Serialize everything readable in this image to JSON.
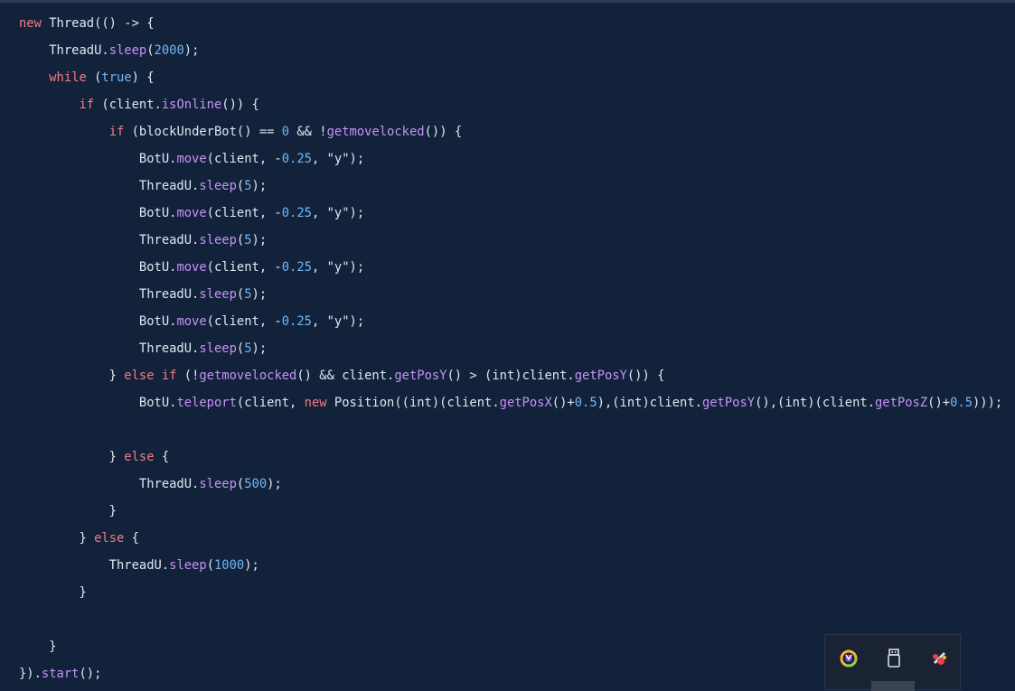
{
  "code_lines": [
    [
      {
        "t": "kw",
        "v": "new"
      },
      {
        "t": "p",
        "v": " Thread(() -> {"
      }
    ],
    [
      {
        "t": "p",
        "v": "    ThreadU."
      },
      {
        "t": "fn",
        "v": "sleep"
      },
      {
        "t": "p",
        "v": "("
      },
      {
        "t": "num",
        "v": "2000"
      },
      {
        "t": "p",
        "v": ");"
      }
    ],
    [
      {
        "t": "p",
        "v": "    "
      },
      {
        "t": "kw",
        "v": "while"
      },
      {
        "t": "p",
        "v": " ("
      },
      {
        "t": "num",
        "v": "true"
      },
      {
        "t": "p",
        "v": ") {"
      }
    ],
    [
      {
        "t": "p",
        "v": "        "
      },
      {
        "t": "kw",
        "v": "if"
      },
      {
        "t": "p",
        "v": " (client."
      },
      {
        "t": "fn",
        "v": "isOnline"
      },
      {
        "t": "p",
        "v": "()) {"
      }
    ],
    [
      {
        "t": "p",
        "v": "            "
      },
      {
        "t": "kw",
        "v": "if"
      },
      {
        "t": "p",
        "v": " (blockUnderBot() == "
      },
      {
        "t": "num",
        "v": "0"
      },
      {
        "t": "p",
        "v": " && !"
      },
      {
        "t": "fn",
        "v": "getmovelocked"
      },
      {
        "t": "p",
        "v": "()) {"
      }
    ],
    [
      {
        "t": "p",
        "v": "                BotU."
      },
      {
        "t": "fn",
        "v": "move"
      },
      {
        "t": "p",
        "v": "(client, -"
      },
      {
        "t": "num",
        "v": "0.25"
      },
      {
        "t": "p",
        "v": ", "
      },
      {
        "t": "str",
        "v": "\"y\""
      },
      {
        "t": "p",
        "v": ");"
      }
    ],
    [
      {
        "t": "p",
        "v": "                ThreadU."
      },
      {
        "t": "fn",
        "v": "sleep"
      },
      {
        "t": "p",
        "v": "("
      },
      {
        "t": "num",
        "v": "5"
      },
      {
        "t": "p",
        "v": ");"
      }
    ],
    [
      {
        "t": "p",
        "v": "                BotU."
      },
      {
        "t": "fn",
        "v": "move"
      },
      {
        "t": "p",
        "v": "(client, -"
      },
      {
        "t": "num",
        "v": "0.25"
      },
      {
        "t": "p",
        "v": ", "
      },
      {
        "t": "str",
        "v": "\"y\""
      },
      {
        "t": "p",
        "v": ");"
      }
    ],
    [
      {
        "t": "p",
        "v": "                ThreadU."
      },
      {
        "t": "fn",
        "v": "sleep"
      },
      {
        "t": "p",
        "v": "("
      },
      {
        "t": "num",
        "v": "5"
      },
      {
        "t": "p",
        "v": ");"
      }
    ],
    [
      {
        "t": "p",
        "v": "                BotU."
      },
      {
        "t": "fn",
        "v": "move"
      },
      {
        "t": "p",
        "v": "(client, -"
      },
      {
        "t": "num",
        "v": "0.25"
      },
      {
        "t": "p",
        "v": ", "
      },
      {
        "t": "str",
        "v": "\"y\""
      },
      {
        "t": "p",
        "v": ");"
      }
    ],
    [
      {
        "t": "p",
        "v": "                ThreadU."
      },
      {
        "t": "fn",
        "v": "sleep"
      },
      {
        "t": "p",
        "v": "("
      },
      {
        "t": "num",
        "v": "5"
      },
      {
        "t": "p",
        "v": ");"
      }
    ],
    [
      {
        "t": "p",
        "v": "                BotU."
      },
      {
        "t": "fn",
        "v": "move"
      },
      {
        "t": "p",
        "v": "(client, -"
      },
      {
        "t": "num",
        "v": "0.25"
      },
      {
        "t": "p",
        "v": ", "
      },
      {
        "t": "str",
        "v": "\"y\""
      },
      {
        "t": "p",
        "v": ");"
      }
    ],
    [
      {
        "t": "p",
        "v": "                ThreadU."
      },
      {
        "t": "fn",
        "v": "sleep"
      },
      {
        "t": "p",
        "v": "("
      },
      {
        "t": "num",
        "v": "5"
      },
      {
        "t": "p",
        "v": ");"
      }
    ],
    [
      {
        "t": "p",
        "v": "            } "
      },
      {
        "t": "kw",
        "v": "else if"
      },
      {
        "t": "p",
        "v": " (!"
      },
      {
        "t": "fn",
        "v": "getmovelocked"
      },
      {
        "t": "p",
        "v": "() && client."
      },
      {
        "t": "fn",
        "v": "getPosY"
      },
      {
        "t": "p",
        "v": "() > (int)client."
      },
      {
        "t": "fn",
        "v": "getPosY"
      },
      {
        "t": "p",
        "v": "()) {"
      }
    ],
    [
      {
        "t": "p",
        "v": "                BotU."
      },
      {
        "t": "fn",
        "v": "teleport"
      },
      {
        "t": "p",
        "v": "(client, "
      },
      {
        "t": "kw",
        "v": "new"
      },
      {
        "t": "p",
        "v": " Position((int)(client."
      },
      {
        "t": "fn",
        "v": "getPosX"
      },
      {
        "t": "p",
        "v": "()+"
      },
      {
        "t": "num",
        "v": "0.5"
      },
      {
        "t": "p",
        "v": "),(int)client."
      },
      {
        "t": "fn",
        "v": "getPosY"
      },
      {
        "t": "p",
        "v": "(),(int)(client."
      },
      {
        "t": "fn",
        "v": "getPosZ"
      },
      {
        "t": "p",
        "v": "()+"
      },
      {
        "t": "num",
        "v": "0.5"
      },
      {
        "t": "p",
        "v": ")));"
      }
    ],
    [
      {
        "t": "p",
        "v": ""
      }
    ],
    [
      {
        "t": "p",
        "v": "            } "
      },
      {
        "t": "kw",
        "v": "else"
      },
      {
        "t": "p",
        "v": " {"
      }
    ],
    [
      {
        "t": "p",
        "v": "                ThreadU."
      },
      {
        "t": "fn",
        "v": "sleep"
      },
      {
        "t": "p",
        "v": "("
      },
      {
        "t": "num",
        "v": "500"
      },
      {
        "t": "p",
        "v": ");"
      }
    ],
    [
      {
        "t": "p",
        "v": "            }"
      }
    ],
    [
      {
        "t": "p",
        "v": "        } "
      },
      {
        "t": "kw",
        "v": "else"
      },
      {
        "t": "p",
        "v": " {"
      }
    ],
    [
      {
        "t": "p",
        "v": "            ThreadU."
      },
      {
        "t": "fn",
        "v": "sleep"
      },
      {
        "t": "p",
        "v": "("
      },
      {
        "t": "num",
        "v": "1000"
      },
      {
        "t": "p",
        "v": ");"
      }
    ],
    [
      {
        "t": "p",
        "v": "        }"
      }
    ],
    [
      {
        "t": "p",
        "v": ""
      }
    ],
    [
      {
        "t": "p",
        "v": "    }"
      }
    ],
    [
      {
        "t": "p",
        "v": "})."
      },
      {
        "t": "fn",
        "v": "start"
      },
      {
        "t": "p",
        "v": "();"
      }
    ]
  ],
  "tray": {
    "icons": [
      "browser-logo-icon",
      "usb-drive-icon",
      "rocket-app-icon"
    ]
  },
  "colors": {
    "background": "#13223b",
    "keyword": "#f47b82",
    "function": "#c592f7",
    "number": "#6fb6f4",
    "plain": "#dfe6f1"
  }
}
